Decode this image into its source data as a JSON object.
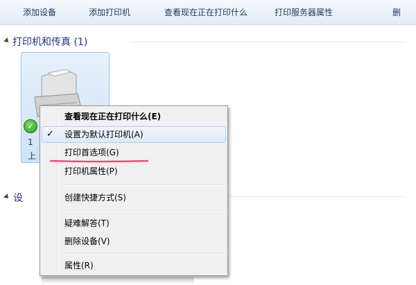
{
  "toolbar": {
    "items": [
      "添加设备",
      "添加打印机",
      "查看现在正在打印什么",
      "打印服务器属性",
      "删"
    ]
  },
  "group": {
    "header": "打印机和传真 (1)",
    "second_header_partial": "设"
  },
  "device": {
    "partial_line1": "1",
    "partial_line2": "上"
  },
  "context_menu": {
    "items": [
      {
        "label": "查看现在正在打印什么(E)",
        "bold": true
      },
      {
        "label": "设置为默认打印机(A)",
        "checked": true,
        "hover": true
      },
      {
        "label": "打印首选项(G)",
        "underlined": true
      },
      {
        "label": "打印机属性(P)"
      },
      {
        "label": "创建快捷方式(S)"
      },
      {
        "label": "疑难解答(T)"
      },
      {
        "label": "删除设备(V)"
      },
      {
        "label": "属性(R)"
      }
    ],
    "checkmark": "✓"
  },
  "colors": {
    "highlight_underline": "#e8507a",
    "check_badge": "#2a9b1c"
  }
}
